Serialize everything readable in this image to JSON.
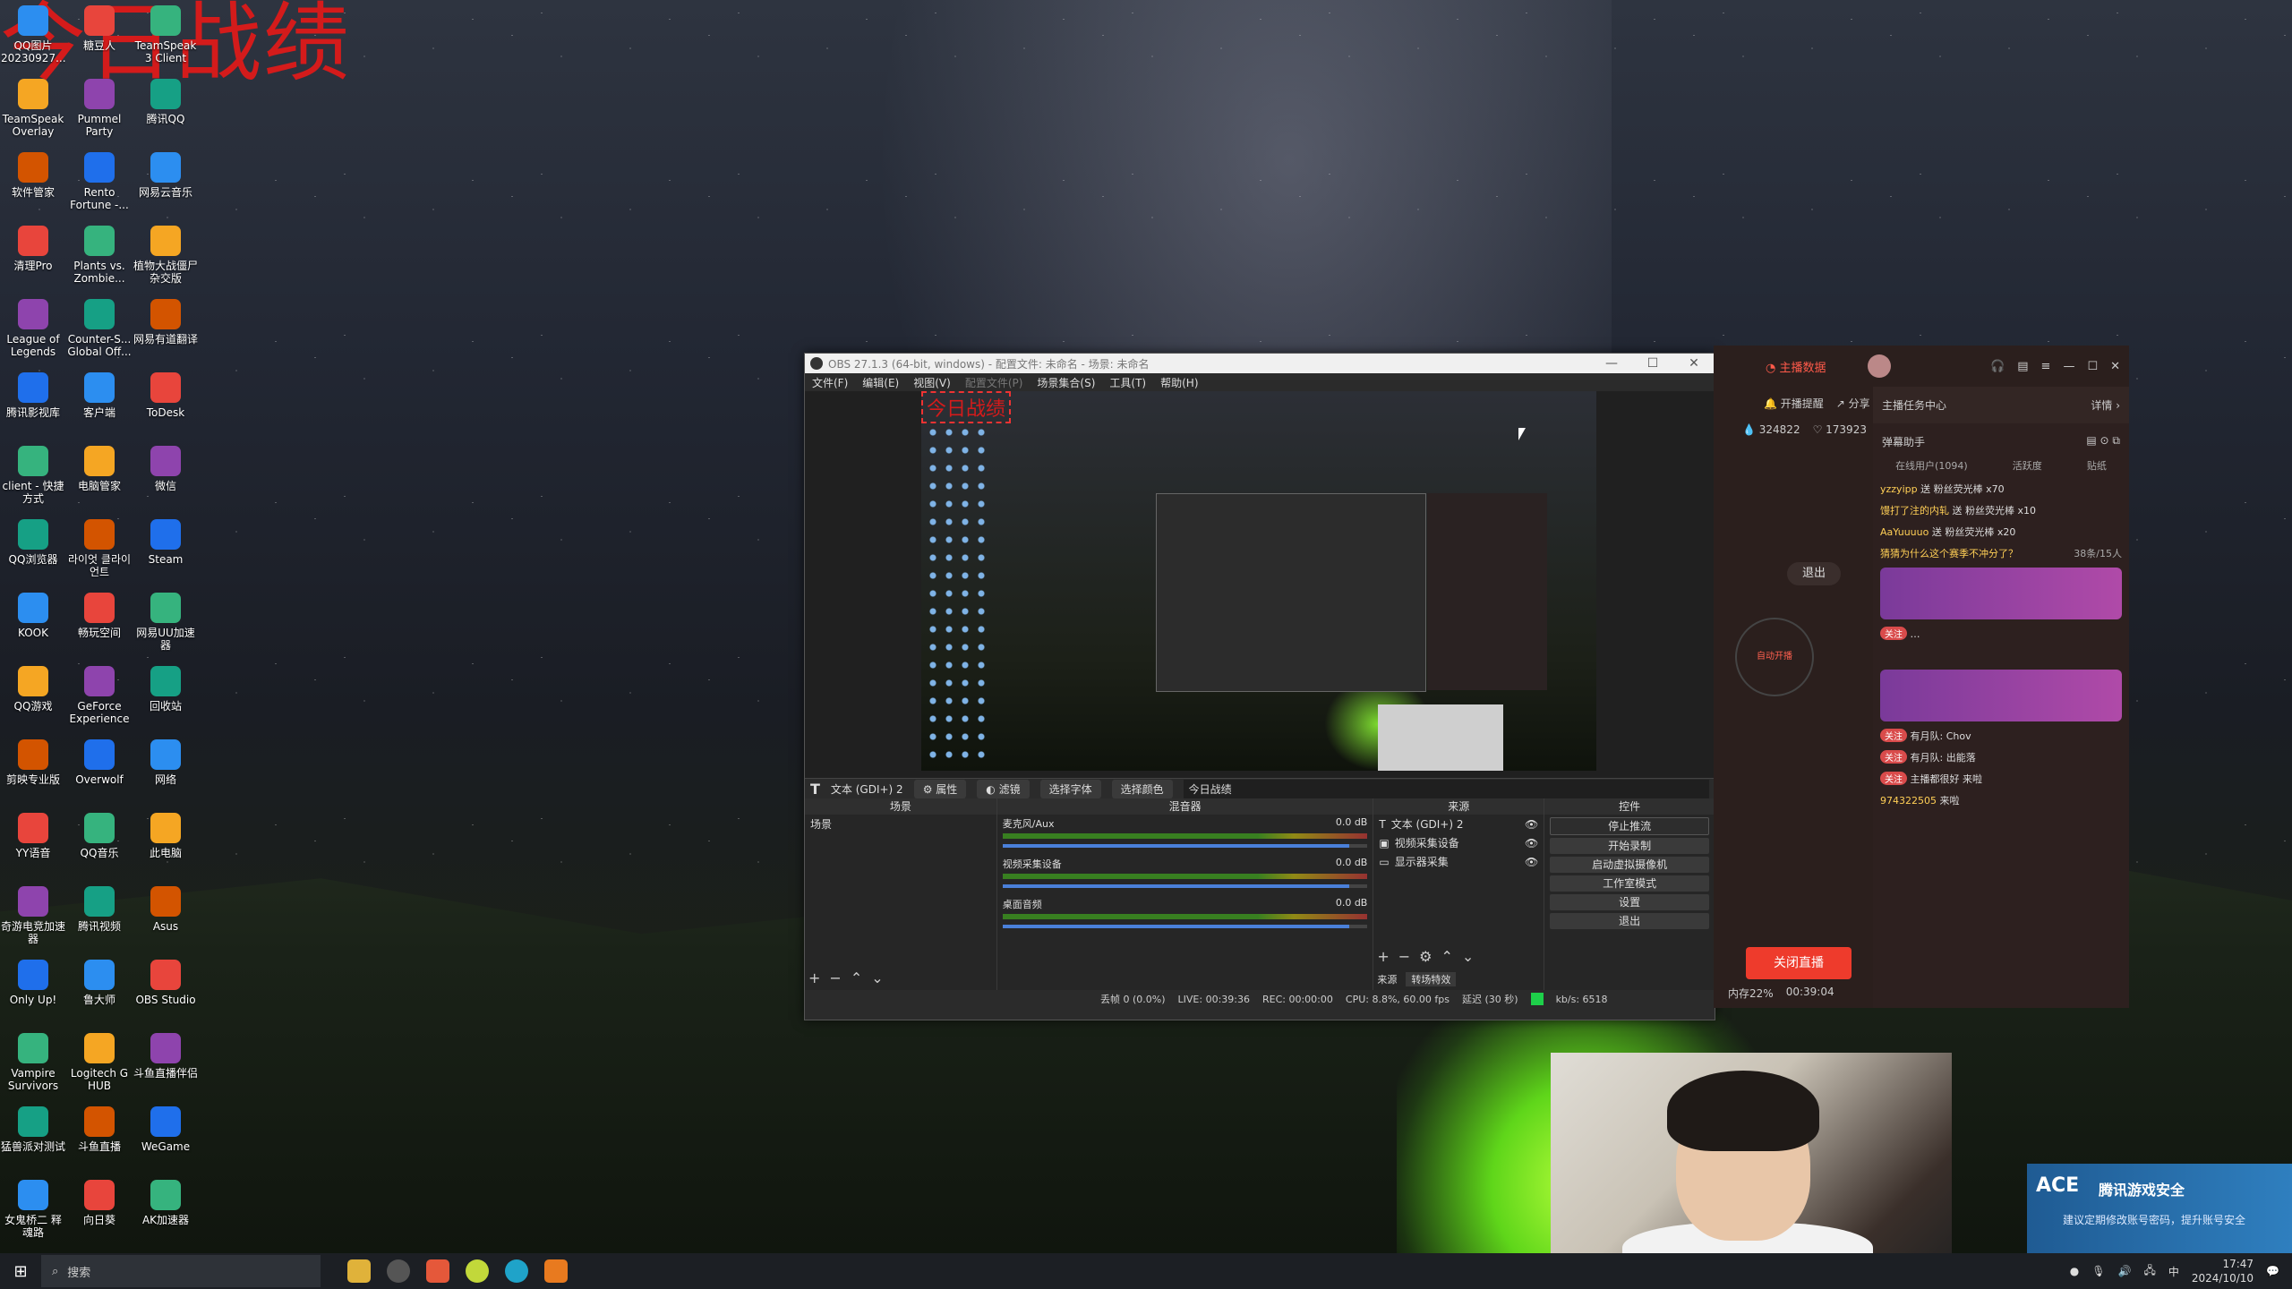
{
  "overlay_title": "今日战绩",
  "desktop_icons": [
    "QQ图片20230927...",
    "糖豆人",
    "TeamSpeak 3 Client",
    "TeamSpeak Overlay",
    "Pummel Party",
    "腾讯QQ",
    "软件管家",
    "Rento Fortune -...",
    "网易云音乐",
    "清理Pro",
    "Plants vs. Zombie...",
    "植物大战僵尸杂交版",
    "League of Legends",
    "Counter-S... Global Off...",
    "网易有道翻译",
    "腾讯影视库",
    "客户端",
    "ToDesk",
    "client - 快捷方式",
    "电脑管家",
    "微信",
    "QQ浏览器",
    "라이엇 클라이언트",
    "Steam",
    "KOOK",
    "畅玩空间",
    "网易UU加速器",
    "QQ游戏",
    "GeForce Experience",
    "回收站",
    "剪映专业版",
    "Overwolf",
    "网络",
    "YY语音",
    "QQ音乐",
    "此电脑",
    "奇游电竞加速器",
    "腾讯视频",
    "Asus",
    "Only Up!",
    "鲁大师",
    "OBS Studio",
    "Vampire Survivors",
    "Logitech G HUB",
    "斗鱼直播伴侣",
    "猛兽派对测试",
    "斗鱼直播",
    "WeGame",
    "女鬼桥二 释魂路",
    "向日葵",
    "AK加速器"
  ],
  "obs": {
    "title": "OBS 27.1.3 (64-bit, windows) - 配置文件: 未命名 - 场景: 未命名",
    "menu": [
      "文件(F)",
      "编辑(E)",
      "视图(V)",
      "配置文件(P)",
      "场景集合(S)",
      "工具(T)",
      "帮助(H)"
    ],
    "source_bar": {
      "source_name": "文本 (GDI+) 2",
      "properties": "属性",
      "filters": "滤镜",
      "select_font": "选择字体",
      "select_color": "选择颜色",
      "text_value": "今日战绩"
    },
    "docks": {
      "scenes_header": "场景",
      "scene_item": "场景",
      "mixer_header": "混音器",
      "channels": [
        {
          "name": "麦克风/Aux",
          "db": "0.0 dB",
          "level": 0.95
        },
        {
          "name": "视频采集设备",
          "db": "0.0 dB",
          "level": 0.95
        },
        {
          "name": "桌面音频",
          "db": "0.0 dB",
          "level": 0.95
        }
      ],
      "sources_header": "来源",
      "sources": [
        "文本 (GDI+) 2",
        "视频采集设备",
        "显示器采集"
      ],
      "source_tabs": [
        "来源",
        "转场特效"
      ],
      "controls_header": "控件",
      "controls": [
        "停止推流",
        "开始录制",
        "启动虚拟摄像机",
        "工作室模式",
        "设置",
        "退出"
      ]
    },
    "status": {
      "dropped": "丢帧 0 (0.0%)",
      "live": "LIVE: 00:39:36",
      "rec": "REC: 00:00:00",
      "cpu": "CPU: 8.8%, 60.00 fps",
      "delay": "延迟 (30 秒)",
      "bitrate": "kb/s: 6518"
    }
  },
  "live_panel": {
    "data_tag": "主播数据",
    "notify": "开播提醒",
    "share": "分享",
    "fans": "324822",
    "likes": "173923",
    "task_center": "主播任务中心",
    "details": "详情",
    "danmu_helper": "弹幕助手",
    "online_users": "在线用户(1094)",
    "active": "活跃度",
    "stickers": "贴纸",
    "exit": "退出",
    "auto_start": "自动开播",
    "close_live": "关闭直播",
    "memory": "内存22%",
    "duration": "00:39:04",
    "count_tag": "38条/15人",
    "chats": [
      {
        "user": "yzzyipp",
        "text": "送 粉丝荧光棒",
        "count": "x70"
      },
      {
        "user": "馒打了注的内轧",
        "text": "送 粉丝荧光棒",
        "count": "x10"
      },
      {
        "user": "AaYuuuuo",
        "text": "送 粉丝荧光棒",
        "count": "x20"
      },
      {
        "user": "",
        "text": "猜猜为什么这个赛季不冲分了？",
        "count": ""
      },
      {
        "user": "",
        "text": "有月队: Chov",
        "count": ""
      },
      {
        "user": "",
        "text": "有月队: 出能落",
        "count": ""
      },
      {
        "user": "",
        "text": "主播都很好 来啦",
        "count": ""
      },
      {
        "user": "974322505",
        "text": "来啦",
        "count": ""
      }
    ]
  },
  "toast": {
    "brand": "ACE",
    "title": "腾讯游戏安全",
    "message": "建议定期修改账号密码，提升账号安全"
  },
  "taskbar": {
    "search_placeholder": "搜索",
    "time": "17:47",
    "date": "2024/10/10",
    "ime": "中"
  }
}
